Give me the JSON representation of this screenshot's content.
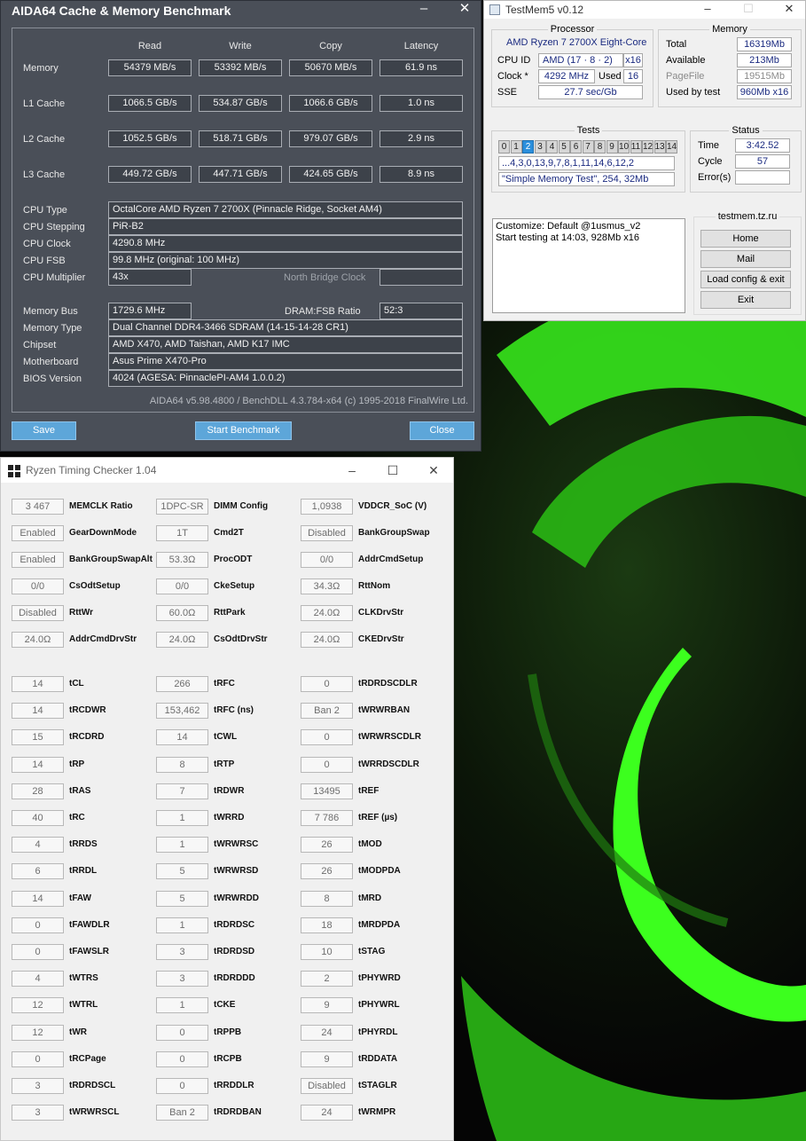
{
  "aida": {
    "title": "AIDA64 Cache & Memory Benchmark",
    "columns": [
      "Read",
      "Write",
      "Copy",
      "Latency"
    ],
    "rows": [
      {
        "label": "Memory",
        "values": [
          "54379 MB/s",
          "53392 MB/s",
          "50670 MB/s",
          "61.9 ns"
        ]
      },
      {
        "label": "L1 Cache",
        "values": [
          "1066.5 GB/s",
          "534.87 GB/s",
          "1066.6 GB/s",
          "1.0 ns"
        ]
      },
      {
        "label": "L2 Cache",
        "values": [
          "1052.5 GB/s",
          "518.71 GB/s",
          "979.07 GB/s",
          "2.9 ns"
        ]
      },
      {
        "label": "L3 Cache",
        "values": [
          "449.72 GB/s",
          "447.71 GB/s",
          "424.65 GB/s",
          "8.9 ns"
        ]
      }
    ],
    "info": {
      "cpu_type_label": "CPU Type",
      "cpu_type": "OctalCore AMD Ryzen 7 2700X  (Pinnacle Ridge, Socket AM4)",
      "cpu_stepping_label": "CPU Stepping",
      "cpu_stepping": "PiR-B2",
      "cpu_clock_label": "CPU Clock",
      "cpu_clock": "4290.8 MHz",
      "cpu_fsb_label": "CPU FSB",
      "cpu_fsb": "99.8 MHz  (original: 100 MHz)",
      "cpu_mult_label": "CPU Multiplier",
      "cpu_mult": "43x",
      "nb_clock_label": "North Bridge Clock",
      "nb_clock": "",
      "mem_bus_label": "Memory Bus",
      "mem_bus": "1729.6 MHz",
      "dram_fsb_label": "DRAM:FSB Ratio",
      "dram_fsb": "52:3",
      "mem_type_label": "Memory Type",
      "mem_type": "Dual Channel DDR4-3466 SDRAM  (14-15-14-28 CR1)",
      "chipset_label": "Chipset",
      "chipset": "AMD X470, AMD Taishan, AMD K17 IMC",
      "motherboard_label": "Motherboard",
      "motherboard": "Asus Prime X470-Pro",
      "bios_label": "BIOS Version",
      "bios": "4024  (AGESA: PinnaclePI-AM4 1.0.0.2)"
    },
    "footer": "AIDA64 v5.98.4800 / BenchDLL 4.3.784-x64  (c) 1995-2018 FinalWire Ltd.",
    "buttons": {
      "save": "Save",
      "start": "Start Benchmark",
      "close": "Close"
    }
  },
  "testmem": {
    "title": "TestMem5 v0.12",
    "processor": {
      "group_title": "Processor",
      "name": "AMD Ryzen 7 2700X Eight-Core",
      "cpuid_label": "CPU ID",
      "cpuid": "AMD  (17 · 8 · 2)",
      "threads": "x16",
      "clock_label": "Clock *",
      "clock": "4292 MHz",
      "used_label": "Used",
      "used": "16",
      "sse_label": "SSE",
      "sse": "27.7 sec/Gb"
    },
    "memory": {
      "group_title": "Memory",
      "total_label": "Total",
      "total": "16319Mb",
      "available_label": "Available",
      "available": "213Mb",
      "pagefile_label": "PageFile",
      "pagefile": "19515Mb",
      "usedbytest_label": "Used by test",
      "usedbytest": "960Mb x16"
    },
    "tests": {
      "group_title": "Tests",
      "numbers": [
        "0",
        "1",
        "2",
        "3",
        "4",
        "5",
        "6",
        "7",
        "8",
        "9",
        "10",
        "11",
        "12",
        "13",
        "14"
      ],
      "active_index": 2,
      "sequence": "...4,3,0,13,9,7,8,1,11,14,6,12,2",
      "current": "\"Simple Memory Test\", 254, 32Mb"
    },
    "status": {
      "group_title": "Status",
      "time_label": "Time",
      "time": "3:42.52",
      "cycle_label": "Cycle",
      "cycle": "57",
      "errors_label": "Error(s)",
      "errors": ""
    },
    "log": [
      "Customize: Default @1usmus_v2",
      "Start testing at 14:03, 928Mb x16"
    ],
    "site": "testmem.tz.ru",
    "buttons": {
      "home": "Home",
      "mail": "Mail",
      "load": "Load config & exit",
      "exit": "Exit"
    }
  },
  "rtc": {
    "title": "Ryzen Timing Checker 1.04",
    "top": [
      [
        {
          "v": "3 467",
          "n": "MEMCLK Ratio"
        },
        {
          "v": "1DPC-SR",
          "n": "DIMM Config"
        },
        {
          "v": "1,0938",
          "n": "VDDCR_SoC (V)"
        }
      ],
      [
        {
          "v": "Enabled",
          "n": "GearDownMode"
        },
        {
          "v": "1T",
          "n": "Cmd2T"
        },
        {
          "v": "Disabled",
          "n": "BankGroupSwap"
        }
      ],
      [
        {
          "v": "Enabled",
          "n": "BankGroupSwapAlt"
        },
        {
          "v": "53.3Ω",
          "n": "ProcODT"
        },
        {
          "v": "0/0",
          "n": "AddrCmdSetup"
        }
      ],
      [
        {
          "v": "0/0",
          "n": "CsOdtSetup"
        },
        {
          "v": "0/0",
          "n": "CkeSetup"
        },
        {
          "v": "34.3Ω",
          "n": "RttNom"
        }
      ],
      [
        {
          "v": "Disabled",
          "n": "RttWr"
        },
        {
          "v": "60.0Ω",
          "n": "RttPark"
        },
        {
          "v": "24.0Ω",
          "n": "CLKDrvStr"
        }
      ],
      [
        {
          "v": "24.0Ω",
          "n": "AddrCmdDrvStr"
        },
        {
          "v": "24.0Ω",
          "n": "CsOdtDrvStr"
        },
        {
          "v": "24.0Ω",
          "n": "CKEDrvStr"
        }
      ]
    ],
    "timings": [
      [
        {
          "v": "14",
          "n": "tCL"
        },
        {
          "v": "266",
          "n": "tRFC"
        },
        {
          "v": "0",
          "n": "tRDRDSCDLR"
        }
      ],
      [
        {
          "v": "14",
          "n": "tRCDWR"
        },
        {
          "v": "153,462",
          "n": "tRFC (ns)"
        },
        {
          "v": "Ban 2",
          "n": "tWRWRBAN"
        }
      ],
      [
        {
          "v": "15",
          "n": "tRCDRD"
        },
        {
          "v": "14",
          "n": "tCWL"
        },
        {
          "v": "0",
          "n": "tWRWRSCDLR"
        }
      ],
      [
        {
          "v": "14",
          "n": "tRP"
        },
        {
          "v": "8",
          "n": "tRTP"
        },
        {
          "v": "0",
          "n": "tWRRDSCDLR"
        }
      ],
      [
        {
          "v": "28",
          "n": "tRAS"
        },
        {
          "v": "7",
          "n": "tRDWR"
        },
        {
          "v": "13495",
          "n": "tREF"
        }
      ],
      [
        {
          "v": "40",
          "n": "tRC"
        },
        {
          "v": "1",
          "n": "tWRRD"
        },
        {
          "v": "7 786",
          "n": "tREF (µs)"
        }
      ],
      [
        {
          "v": "4",
          "n": "tRRDS"
        },
        {
          "v": "1",
          "n": "tWRWRSC"
        },
        {
          "v": "26",
          "n": "tMOD"
        }
      ],
      [
        {
          "v": "6",
          "n": "tRRDL"
        },
        {
          "v": "5",
          "n": "tWRWRSD"
        },
        {
          "v": "26",
          "n": "tMODPDA"
        }
      ],
      [
        {
          "v": "14",
          "n": "tFAW"
        },
        {
          "v": "5",
          "n": "tWRWRDD"
        },
        {
          "v": "8",
          "n": "tMRD"
        }
      ],
      [
        {
          "v": "0",
          "n": "tFAWDLR"
        },
        {
          "v": "1",
          "n": "tRDRDSC"
        },
        {
          "v": "18",
          "n": "tMRDPDA"
        }
      ],
      [
        {
          "v": "0",
          "n": "tFAWSLR"
        },
        {
          "v": "3",
          "n": "tRDRDSD"
        },
        {
          "v": "10",
          "n": "tSTAG"
        }
      ],
      [
        {
          "v": "4",
          "n": "tWTRS"
        },
        {
          "v": "3",
          "n": "tRDRDDD"
        },
        {
          "v": "2",
          "n": "tPHYWRD"
        }
      ],
      [
        {
          "v": "12",
          "n": "tWTRL"
        },
        {
          "v": "1",
          "n": "tCKE"
        },
        {
          "v": "9",
          "n": "tPHYWRL"
        }
      ],
      [
        {
          "v": "12",
          "n": "tWR"
        },
        {
          "v": "0",
          "n": "tRPPB"
        },
        {
          "v": "24",
          "n": "tPHYRDL"
        }
      ],
      [
        {
          "v": "0",
          "n": "tRCPage"
        },
        {
          "v": "0",
          "n": "tRCPB"
        },
        {
          "v": "9",
          "n": "tRDDATA"
        }
      ],
      [
        {
          "v": "3",
          "n": "tRDRDSCL"
        },
        {
          "v": "0",
          "n": "tRRDDLR"
        },
        {
          "v": "Disabled",
          "n": "tSTAGLR"
        }
      ],
      [
        {
          "v": "3",
          "n": "tWRWRSCL"
        },
        {
          "v": "Ban 2",
          "n": "tRDRDBAN"
        },
        {
          "v": "24",
          "n": "tWRMPR"
        }
      ]
    ]
  },
  "colors": {
    "accent_green": "#3cff1e",
    "aida_bg": "#4a4f58",
    "aida_button": "#5da6d9",
    "test_active": "#2b8fdc"
  }
}
